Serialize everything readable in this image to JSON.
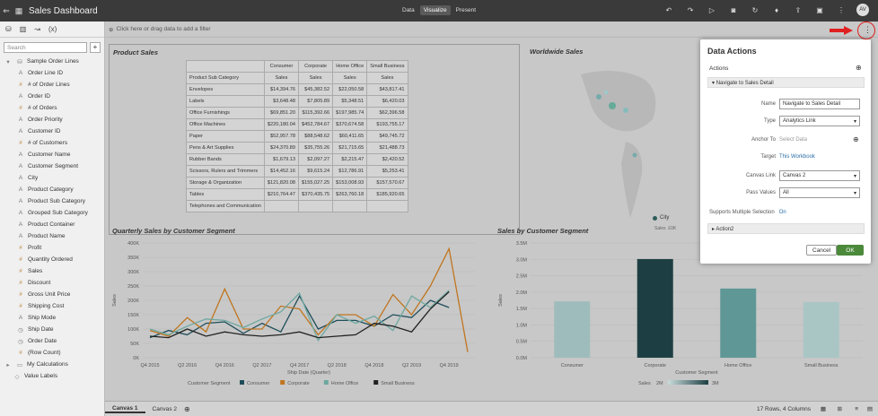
{
  "app": {
    "title": "Sales Dashboard",
    "modes": [
      "Data",
      "Visualize",
      "Present"
    ],
    "active_mode": "Visualize",
    "user_initials": "AV"
  },
  "left_panel": {
    "search_placeholder": "Search",
    "root": "Sample Order Lines",
    "items": [
      {
        "label": "Order Line ID",
        "icon": "A"
      },
      {
        "label": "# of Order Lines",
        "icon": "#"
      },
      {
        "label": "Order ID",
        "icon": "A"
      },
      {
        "label": "# of Orders",
        "icon": "#"
      },
      {
        "label": "Order Priority",
        "icon": "A"
      },
      {
        "label": "Customer ID",
        "icon": "A"
      },
      {
        "label": "# of Customers",
        "icon": "#"
      },
      {
        "label": "Customer Name",
        "icon": "A"
      },
      {
        "label": "Customer Segment",
        "icon": "A"
      },
      {
        "label": "City",
        "icon": "A"
      },
      {
        "label": "Product Category",
        "icon": "A"
      },
      {
        "label": "Product Sub Category",
        "icon": "A"
      },
      {
        "label": "Grouped Sub Category",
        "icon": "A"
      },
      {
        "label": "Product Container",
        "icon": "A"
      },
      {
        "label": "Product Name",
        "icon": "A"
      },
      {
        "label": "Profit",
        "icon": "#"
      },
      {
        "label": "Quantity Ordered",
        "icon": "#"
      },
      {
        "label": "Sales",
        "icon": "#"
      },
      {
        "label": "Discount",
        "icon": "#"
      },
      {
        "label": "Gross Unit Price",
        "icon": "#"
      },
      {
        "label": "Shipping Cost",
        "icon": "#"
      },
      {
        "label": "Ship Mode",
        "icon": "A"
      },
      {
        "label": "Ship Date",
        "icon": "◷"
      },
      {
        "label": "Order Date",
        "icon": "◷"
      },
      {
        "label": "(Row Count)",
        "icon": "#"
      }
    ],
    "my_calculations": "My Calculations",
    "value_labels": "Value Labels"
  },
  "filter_bar": "Click here or drag data to add a filter",
  "product_sales": {
    "title": "Product Sales",
    "col_header": "Product Sub Category",
    "segments": [
      "Consumer",
      "Corporate",
      "Home Office",
      "Small Business"
    ],
    "measure": "Sales",
    "rows": [
      [
        "Envelopes",
        "$14,394.76",
        "$45,382.52",
        "$22,050.58",
        "$43,817.41"
      ],
      [
        "Labels",
        "$3,648.48",
        "$7,805.89",
        "$5,348.51",
        "$6,420.03"
      ],
      [
        "Office Furnishings",
        "$69,851.20",
        "$115,392.66",
        "$197,985.74",
        "$62,396.58"
      ],
      [
        "Office Machines",
        "$220,180.04",
        "$452,784.67",
        "$370,674.58",
        "$193,755.17"
      ],
      [
        "Paper",
        "$52,957.78",
        "$88,548.62",
        "$60,411.65",
        "$49,745.72"
      ],
      [
        "Pens & Art Supplies",
        "$24,370.89",
        "$35,755.26",
        "$21,715.65",
        "$21,488.73"
      ],
      [
        "Rubber Bands",
        "$1,679.13",
        "$2,097.27",
        "$2,215.47",
        "$2,420.52"
      ],
      [
        "Scissors, Rulers and Trimmers",
        "$14,452.16",
        "$9,615.24",
        "$12,786.91",
        "$5,253.41"
      ],
      [
        "Storage & Organization",
        "$121,820.08",
        "$155,027.25",
        "$153,008.93",
        "$157,570.67"
      ],
      [
        "Tables",
        "$210,764.47",
        "$370,435.75",
        "$263,760.18",
        "$185,920.65"
      ],
      [
        "Telephones and Communication",
        "",
        "",
        "",
        ""
      ]
    ]
  },
  "worldwide": {
    "title": "Worldwide Sales",
    "legend": "City",
    "legend2": "Sales",
    "legend3": "£0K"
  },
  "quarterly": {
    "title": "Quarterly Sales by Customer Segment",
    "ylabel": "Sales",
    "xlabel": "Ship Date (Quarter)",
    "legend_title": "Customer Segment"
  },
  "segment_bar": {
    "title": "Sales by Customer Segment",
    "ylabel": "Sales",
    "xlabel": "Customer Segment",
    "legend_title": "Sales",
    "legend_min": "2M",
    "legend_max": "3M"
  },
  "chart_data": [
    {
      "type": "line",
      "title": "Quarterly Sales by Customer Segment",
      "xlabel": "Ship Date (Quarter)",
      "ylabel": "Sales",
      "x": [
        "Q4 2015",
        "Q1 2016",
        "Q2 2016",
        "Q3 2016",
        "Q4 2016",
        "Q1 2017",
        "Q2 2017",
        "Q3 2017",
        "Q4 2017",
        "Q1 2018",
        "Q2 2018",
        "Q3 2018",
        "Q4 2018",
        "Q1 2019",
        "Q2 2019",
        "Q3 2019",
        "Q4 2019",
        "Q1 2020"
      ],
      "xticks": [
        "Q4 2015",
        "Q2 2016",
        "Q4 2016",
        "Q2 2017",
        "Q4 2017",
        "Q2 2018",
        "Q4 2018",
        "Q2 2019",
        "Q4 2019"
      ],
      "yticks": [
        "0K",
        "50K",
        "100K",
        "150K",
        "200K",
        "250K",
        "300K",
        "350K",
        "400K"
      ],
      "ylim": [
        0,
        400000
      ],
      "series": [
        {
          "name": "Consumer",
          "color": "#1f4d5a",
          "values": [
            70000,
            95000,
            80000,
            120000,
            125000,
            85000,
            120000,
            90000,
            215000,
            100000,
            130000,
            130000,
            110000,
            150000,
            140000,
            200000,
            175000,
            null
          ]
        },
        {
          "name": "Corporate",
          "color": "#c0751e",
          "values": [
            95000,
            75000,
            140000,
            90000,
            240000,
            100000,
            100000,
            180000,
            170000,
            80000,
            150000,
            150000,
            110000,
            220000,
            150000,
            250000,
            380000,
            20000
          ]
        },
        {
          "name": "Home Office",
          "color": "#6da8a0",
          "values": [
            100000,
            80000,
            110000,
            135000,
            130000,
            105000,
            135000,
            160000,
            225000,
            60000,
            150000,
            120000,
            145000,
            95000,
            215000,
            175000,
            235000,
            null
          ]
        },
        {
          "name": "Small Business",
          "color": "#222222",
          "values": [
            75000,
            70000,
            100000,
            75000,
            90000,
            80000,
            75000,
            80000,
            90000,
            70000,
            75000,
            80000,
            120000,
            110000,
            90000,
            170000,
            230000,
            null
          ]
        }
      ]
    },
    {
      "type": "bar",
      "title": "Sales by Customer Segment",
      "xlabel": "Customer Segment",
      "ylabel": "Sales",
      "categories": [
        "Consumer",
        "Corporate",
        "Home Office",
        "Small Business"
      ],
      "values": [
        1720000,
        3010000,
        2110000,
        1700000
      ],
      "yticks": [
        "0.0M",
        "0.5M",
        "1.0M",
        "1.5M",
        "2.0M",
        "2.5M",
        "3.0M",
        "3.5M"
      ],
      "ylim": [
        0,
        3500000
      ]
    }
  ],
  "data_actions": {
    "title": "Data Actions",
    "actions_label": "Actions",
    "action1": "Navigate to Sales Detail",
    "name_label": "Name",
    "name_value": "Navigate to Sales Detail",
    "type_label": "Type",
    "type_value": "Analytics Link",
    "anchor_label": "Anchor To",
    "anchor_placeholder": "Select Data",
    "target_label": "Target",
    "target_value": "This Workbook",
    "canvas_label": "Canvas Link",
    "canvas_value": "Canvas 2",
    "pass_label": "Pass Values",
    "pass_value": "All",
    "multi_label": "Supports Multiple Selection",
    "multi_value": "On",
    "action2": "Action2",
    "cancel": "Cancel",
    "ok": "OK"
  },
  "bottom": {
    "tabs": [
      "Canvas 1",
      "Canvas 2"
    ],
    "status": "17 Rows, 4 Columns"
  }
}
